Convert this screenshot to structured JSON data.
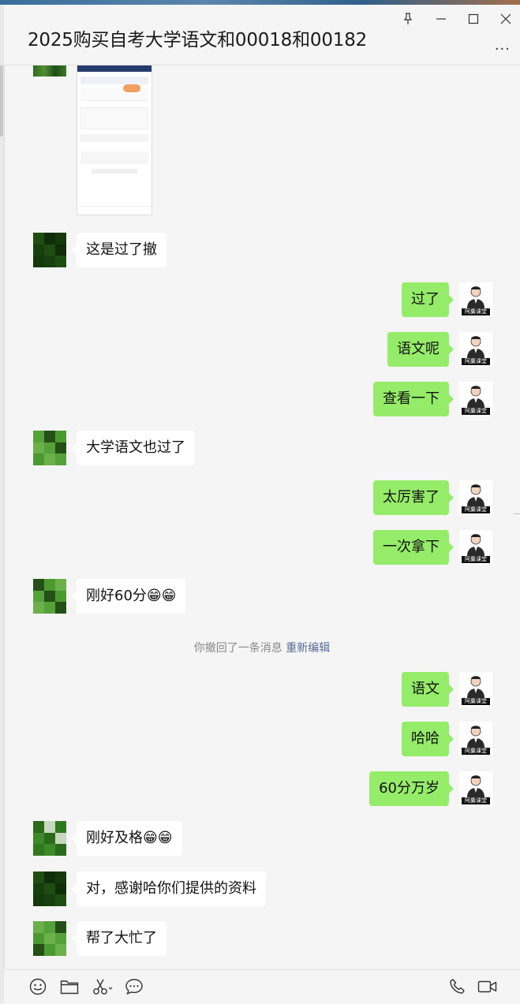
{
  "window": {
    "title": "2025购买自考大学语文和00018和00182",
    "controls": [
      "pin-icon",
      "minimize-icon",
      "maximize-icon",
      "close-icon"
    ],
    "more": "···"
  },
  "messages": [
    {
      "side": "left",
      "text": "这是过了撤"
    },
    {
      "side": "right",
      "text": "过了"
    },
    {
      "side": "right",
      "text": "语文呢"
    },
    {
      "side": "right",
      "text": "查看一下"
    },
    {
      "side": "left",
      "text": "大学语文也过了"
    },
    {
      "side": "right",
      "text": "太厉害了"
    },
    {
      "side": "right",
      "text": "一次拿下"
    },
    {
      "side": "left",
      "text": "刚好60分😁😁"
    },
    {
      "side": "right",
      "text": "语文"
    },
    {
      "side": "right",
      "text": "哈哈"
    },
    {
      "side": "right",
      "text": "60分万岁"
    },
    {
      "side": "left",
      "text": "刚好及格😁😁"
    },
    {
      "side": "left",
      "text": "对，感谢哈你们提供的资料"
    },
    {
      "side": "left",
      "text": "帮了大忙了"
    }
  ],
  "notice": {
    "text": "你撤回了一条消息",
    "link": "重新编辑"
  },
  "avatar_right_label": "阿麋课堂",
  "toolbar": {
    "left": [
      "emoji-icon",
      "folder-icon",
      "scissors-icon",
      "chat-history-icon"
    ],
    "right": [
      "phone-icon",
      "video-call-icon"
    ]
  },
  "colors": {
    "bubble_right": "#95ec69",
    "bubble_left": "#ffffff",
    "background": "#f5f5f5",
    "link": "#576b95"
  }
}
